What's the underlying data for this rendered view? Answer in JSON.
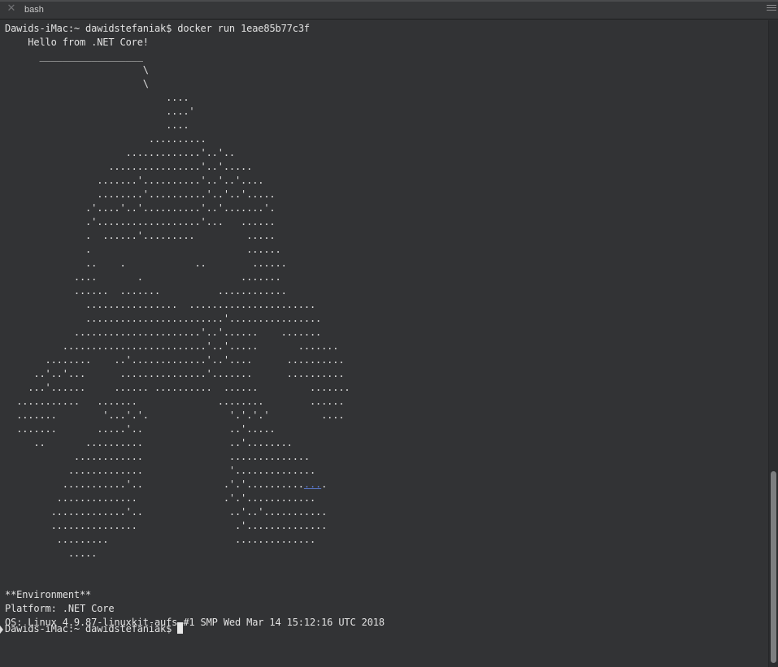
{
  "window": {
    "tab_title": "bash",
    "close_glyph": "✕",
    "menu_icon": "hamburger-menu-icon"
  },
  "terminal": {
    "prompt": "Dawids-iMac:~ dawidstefaniak$",
    "command": "docker run 1eae85b77c3f",
    "output_lines": [
      "    Hello from .NET Core!",
      "      __________________",
      "                        \\",
      "                        \\",
      "                            ....",
      "                            ....'",
      "                            ....",
      "                         ..........",
      "                     .............'..'..",
      "                  ................'..'.....",
      "                .......'..........'..'..'....",
      "                ........'..........'..'..'.....",
      "              .'....'..'..........'..'.......'.",
      "              .'..................'...   ......",
      "              .  ......'.........         .....",
      "              .                           ......",
      "              ..    .            ..        ......",
      "            ....       .                 .......",
      "            ......  .......          ............",
      "              ................  ......................",
      "              ........................'................",
      "            ......................'..'......    .......",
      "          .........................'..'.....       .......",
      "       ........    ..'.............'..'....      ..........",
      "     ..'..'...      ...............'.......      ..........",
      "    ...'......     ...... ..........  ......         .......",
      "  ...........   .......              ........        ......",
      "  .......        '...'.'.              '.'.'.'         ....",
      "  .......       .....'..               ..'.....",
      "     ..       ..........               ..'........",
      "            ............               ..............",
      "           .............               '..............",
      "          ...........'..              .'.'.........."
    ],
    "link_fragment": "...",
    "link_line_suffix": ".",
    "output_lines_after": [
      "         ..............               .'.'............",
      "        .............'..               ..'..'...........",
      "        ...............                 .'..............",
      "         .........                      ..............",
      "           .....",
      "",
      "",
      "**Environment**",
      "Platform: .NET Core",
      "OS: Linux 4.9.87-linuxkit-aufs #1 SMP Wed Mar 14 15:12:16 UTC 2018"
    ]
  },
  "colors": {
    "background": "#323335",
    "text": "#e2e2e2",
    "link": "#5a78c8",
    "scroll_thumb": "#7d7e80"
  }
}
